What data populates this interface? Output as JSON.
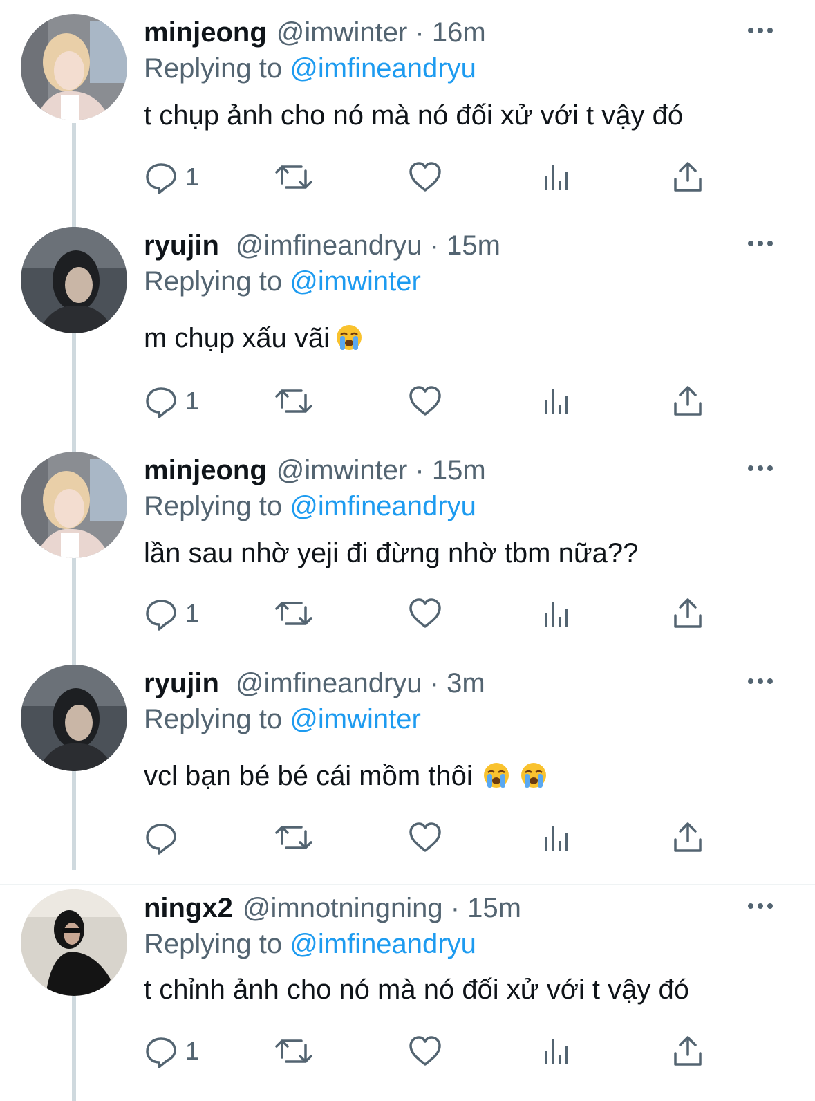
{
  "tweets": [
    {
      "name": "minjeong",
      "handle": "@imwinter",
      "time": "· 16m",
      "replying_prefix": "Replying to",
      "replying_to": "@imfineandryu",
      "text": "t chụp ảnh cho nó mà nó đối xử với t vậy đó",
      "emoji_count": 0,
      "reply_count": "1"
    },
    {
      "name": "ryujin",
      "handle": "@imfineandryu",
      "time": "· 15m",
      "replying_prefix": "Replying to",
      "replying_to": "@imwinter",
      "text": "m chụp xấu vãi",
      "emoji_count": 1,
      "reply_count": "1"
    },
    {
      "name": "minjeong",
      "handle": "@imwinter",
      "time": "· 15m",
      "replying_prefix": "Replying to",
      "replying_to": "@imfineandryu",
      "text": "lần sau nhờ yeji đi đừng nhờ tbm nữa??",
      "emoji_count": 0,
      "reply_count": "1"
    },
    {
      "name": "ryujin",
      "handle": "@imfineandryu",
      "time": "· 3m",
      "replying_prefix": "Replying to",
      "replying_to": "@imwinter",
      "text": "vcl bạn bé bé cái mồm thôi",
      "emoji_count": 2,
      "reply_count": ""
    },
    {
      "name": "ningx2",
      "handle": "@imnotningning",
      "time": "· 15m",
      "replying_prefix": "Replying to",
      "replying_to": "@imfineandryu",
      "text": "t chỉnh ảnh cho nó mà nó đối xử với t vậy đó",
      "emoji_count": 0,
      "reply_count": "1"
    }
  ],
  "icons": {
    "reply": "reply-icon",
    "retweet": "retweet-icon",
    "like": "heart-icon",
    "views": "analytics-icon",
    "share": "share-icon",
    "more": "more-icon",
    "emoji": "loudly-crying-face-emoji"
  },
  "colors": {
    "text": "#0f1419",
    "secondary": "#536471",
    "mention": "#1d9bf0",
    "thread_line": "#cfd9de"
  }
}
